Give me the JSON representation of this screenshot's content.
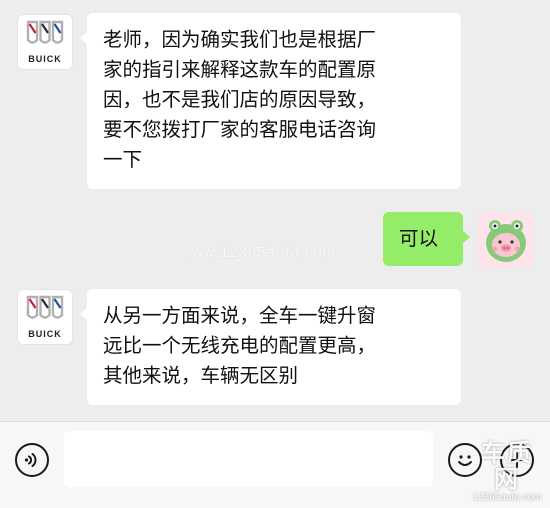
{
  "messages": [
    {
      "sender": "buick",
      "side": "left",
      "avatar_text": "BUICK",
      "lines": [
        "老师，因为确实我们也是根据厂",
        "家的指引来解释这款车的配置原",
        "因，也不是我们店的原因导致，",
        "要不您拨打厂家的客服电话咨询",
        "一下"
      ]
    },
    {
      "sender": "user",
      "side": "right",
      "lines": [
        "可以"
      ]
    },
    {
      "sender": "buick",
      "side": "left",
      "avatar_text": "BUICK",
      "lines": [
        "从另一方面来说，全车一键升窗",
        "远比一个无线充电的配置更高，",
        "其他来说，车辆无区别"
      ]
    }
  ],
  "watermark": "www.12365auto.com",
  "corner_logo": {
    "big": "车质网",
    "small": "12365auto.com"
  },
  "input_bar": {
    "message_value": ""
  },
  "colors": {
    "chat_background": "#ededed",
    "incoming_bubble": "#ffffff",
    "outgoing_bubble": "#95ec69",
    "input_bar": "#f7f7f7"
  },
  "icons": {
    "voice": "voice-icon",
    "emoji": "emoji-icon",
    "more": "plus-icon"
  }
}
